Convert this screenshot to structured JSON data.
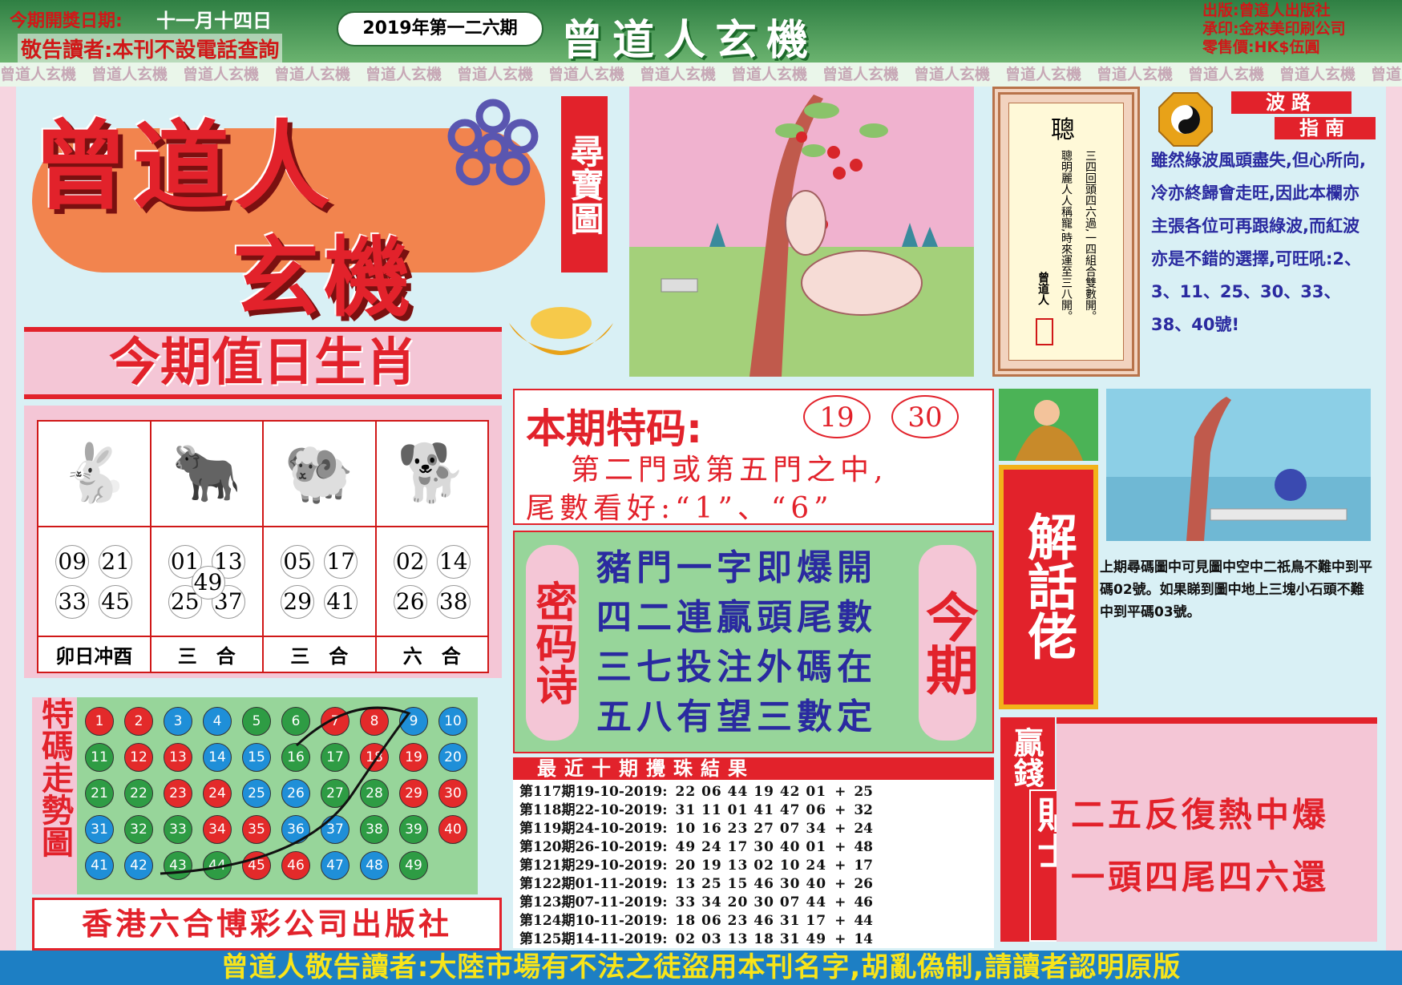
{
  "header": {
    "draw_date_label": "今期開獎日期:",
    "draw_date": "十一月十四日",
    "notice": "敬告讀者:本刊不設電話查詢",
    "issue": "2019年第一二六期",
    "brand": "曾道人玄機",
    "publisher": "出版:曾道人出版社",
    "printer": "承印:金來美印刷公司",
    "price": "零售價:HK$伍圓"
  },
  "strip_text": "曾道人玄機",
  "logo": {
    "line1": "曾道人",
    "line2": "玄機"
  },
  "treasure_label": "尋寶圖",
  "zodiac": {
    "title": "今期值日生肖",
    "cols": [
      {
        "animal": "🐇",
        "nums": [
          "09",
          "21",
          "33",
          "45"
        ],
        "extra": "",
        "caption": "卯日冲酉"
      },
      {
        "animal": "🐂",
        "nums": [
          "01",
          "13",
          "25",
          "37"
        ],
        "extra": "49",
        "caption": "三　合"
      },
      {
        "animal": "🐏",
        "nums": [
          "05",
          "17",
          "29",
          "41"
        ],
        "extra": "",
        "caption": "三　合"
      },
      {
        "animal": "🐕",
        "nums": [
          "02",
          "14",
          "26",
          "38"
        ],
        "extra": "",
        "caption": "六　合"
      }
    ]
  },
  "trend": {
    "title": "特碼走勢圖"
  },
  "balls": [
    [
      "1",
      "red"
    ],
    [
      "2",
      "red"
    ],
    [
      "3",
      "blue"
    ],
    [
      "4",
      "blue"
    ],
    [
      "5",
      "green"
    ],
    [
      "6",
      "green"
    ],
    [
      "7",
      "red"
    ],
    [
      "8",
      "red"
    ],
    [
      "9",
      "blue"
    ],
    [
      "10",
      "blue"
    ],
    [
      "11",
      "green"
    ],
    [
      "12",
      "red"
    ],
    [
      "13",
      "red"
    ],
    [
      "14",
      "blue"
    ],
    [
      "15",
      "blue"
    ],
    [
      "16",
      "green"
    ],
    [
      "17",
      "green"
    ],
    [
      "18",
      "red"
    ],
    [
      "19",
      "red"
    ],
    [
      "20",
      "blue"
    ],
    [
      "21",
      "green"
    ],
    [
      "22",
      "green"
    ],
    [
      "23",
      "red"
    ],
    [
      "24",
      "red"
    ],
    [
      "25",
      "blue"
    ],
    [
      "26",
      "blue"
    ],
    [
      "27",
      "green"
    ],
    [
      "28",
      "green"
    ],
    [
      "29",
      "red"
    ],
    [
      "30",
      "red"
    ],
    [
      "31",
      "blue"
    ],
    [
      "32",
      "green"
    ],
    [
      "33",
      "green"
    ],
    [
      "34",
      "red"
    ],
    [
      "35",
      "red"
    ],
    [
      "36",
      "blue"
    ],
    [
      "37",
      "blue"
    ],
    [
      "38",
      "green"
    ],
    [
      "39",
      "green"
    ],
    [
      "40",
      "red"
    ],
    [
      "41",
      "blue"
    ],
    [
      "42",
      "blue"
    ],
    [
      "43",
      "green"
    ],
    [
      "44",
      "green"
    ],
    [
      "45",
      "red"
    ],
    [
      "46",
      "red"
    ],
    [
      "47",
      "blue"
    ],
    [
      "48",
      "blue"
    ],
    [
      "49",
      "green"
    ]
  ],
  "footer_publisher": "香港六合博彩公司出版社",
  "special": {
    "title": "本期特码:",
    "num1": "19",
    "num2": "30",
    "line1": "第二門或第五門之中,",
    "line2": "尾數看好:“1”、“6”"
  },
  "poem": {
    "left": "密码诗",
    "right": "今期",
    "lines": [
      "豬門一字即爆開",
      "四二連贏頭尾數",
      "三七投注外碼在",
      "五八有望三數定"
    ]
  },
  "history": {
    "title": "最近十期攪珠結果",
    "rows": [
      {
        "p": "第117期19-10-2019:",
        "n": "22 06 44 19 42 01",
        "s": "25"
      },
      {
        "p": "第118期22-10-2019:",
        "n": "31 11 01 41 47 06",
        "s": "32"
      },
      {
        "p": "第119期24-10-2019:",
        "n": "10 16 23 27 07 34",
        "s": "24"
      },
      {
        "p": "第120期26-10-2019:",
        "n": "49 24 17 30 40 01",
        "s": "48"
      },
      {
        "p": "第121期29-10-2019:",
        "n": "20 19 13 02 10 24",
        "s": "17"
      },
      {
        "p": "第122期01-11-2019:",
        "n": "13 25 15 46 30 40",
        "s": "26"
      },
      {
        "p": "第123期07-11-2019:",
        "n": "33 34 20 30 07 44",
        "s": "46"
      },
      {
        "p": "第124期10-11-2019:",
        "n": "18 06 23 46 31 17",
        "s": "44"
      },
      {
        "p": "第125期14-11-2019:",
        "n": "02 03 13 18 31 49",
        "s": "14"
      }
    ]
  },
  "scroll": {
    "title": "聰",
    "col1": "三四回頭四六過,一四組合雙數開。",
    "col2": "聰明麗人人稱寵,時來運至三八開。",
    "sign": "曾道人"
  },
  "wave": {
    "tag1": "波路",
    "tag2": "指南",
    "text": "雖然綠波風頭盡失,但心所向,冷亦終歸會走旺,因此本欄亦主張各位可再跟綠波,而紅波亦是不錯的選擇,可旺吼:2、3、11、25、30、33、38、40號!"
  },
  "explain": {
    "label": "解話佬",
    "text": "上期尋碼圖中可見圖中空中二祇鳥不難中到平碼02號。如果睇到圖中地上三塊小石頭不難中到平碼03號。"
  },
  "tip": {
    "label1": "贏錢",
    "label2": "貼士",
    "line1": "二五反復熱中爆",
    "line2": "一頭四尾四六還"
  },
  "bottom_notice": "曾道人敬告讀者:大陸市場有不法之徒盜用本刊名字,胡亂偽制,請讀者認明原版",
  "colors": {
    "red": "#e2222b",
    "green": "#2e9c44",
    "blue": "#1f8fd8",
    "pink": "#f4c6d6"
  }
}
